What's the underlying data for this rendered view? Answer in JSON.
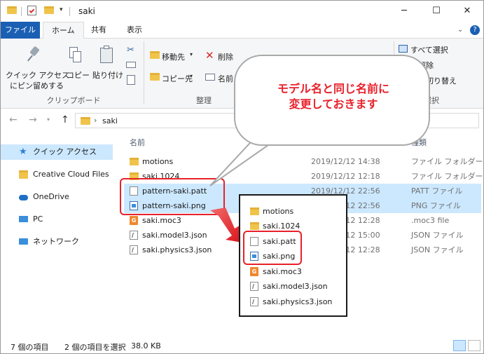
{
  "window": {
    "title": "saki",
    "minimize": "─",
    "maximize": "☐",
    "close": "✕"
  },
  "tabs": {
    "file": "ファイル",
    "home": "ホーム",
    "share": "共有",
    "view": "表示"
  },
  "ribbon": {
    "pin_quick_access": "クイック アクセス",
    "pin_quick_access_2": "にピン留めする",
    "copy": "コピー",
    "paste": "貼り付け",
    "clipboard_group": "クリップボード",
    "move_to": "移動先",
    "copy_to": "コピー先",
    "delete": "削除",
    "rename": "名前",
    "organize_group": "整理",
    "select_all": "すべて選択",
    "select_none": "択解除",
    "invert_selection": "択の切り替え",
    "select_group": "選択"
  },
  "address": {
    "path": "saki",
    "chevron": "›"
  },
  "nav": {
    "items": [
      {
        "label": "クイック アクセス"
      },
      {
        "label": "Creative Cloud Files"
      },
      {
        "label": "OneDrive"
      },
      {
        "label": "PC"
      },
      {
        "label": "ネットワーク"
      }
    ]
  },
  "columns": {
    "name": "名前",
    "type": "種類"
  },
  "files": [
    {
      "name": "motions",
      "date": "2019/12/12 14:38",
      "type": "ファイル フォルダー"
    },
    {
      "name": "saki.1024",
      "date": "2019/12/12 12:18",
      "type": "ファイル フォルダー"
    },
    {
      "name": "pattern-saki.patt",
      "date": "2019/12/12 22:56",
      "type": "PATT ファイル"
    },
    {
      "name": "pattern-saki.png",
      "date": "2019/12/12 22:56",
      "type": "PNG ファイル"
    },
    {
      "name": "saki.moc3",
      "date": "2019/12/12 12:28",
      "type": ".moc3 file"
    },
    {
      "name": "saki.model3.json",
      "date": "2019/12/12 15:00",
      "type": "JSON ファイル"
    },
    {
      "name": "saki.physics3.json",
      "date": "2019/12/12 12:28",
      "type": "JSON ファイル"
    }
  ],
  "popup_files": [
    {
      "name": "motions"
    },
    {
      "name": "saki.1024"
    },
    {
      "name": "saki.patt"
    },
    {
      "name": "saki.png"
    },
    {
      "name": "saki.moc3"
    },
    {
      "name": "saki.model3.json"
    },
    {
      "name": "saki.physics3.json"
    }
  ],
  "callout": {
    "line1": "モデル名と同じ名前に",
    "line2": "変更しておきます"
  },
  "status": {
    "item_count": "7 個の項目",
    "selected": "2 個の項目を選択",
    "size": "38.0 KB"
  },
  "colors": {
    "accent": "#1a5fb4",
    "selection": "#cce8ff",
    "highlight": "#e8202a"
  }
}
